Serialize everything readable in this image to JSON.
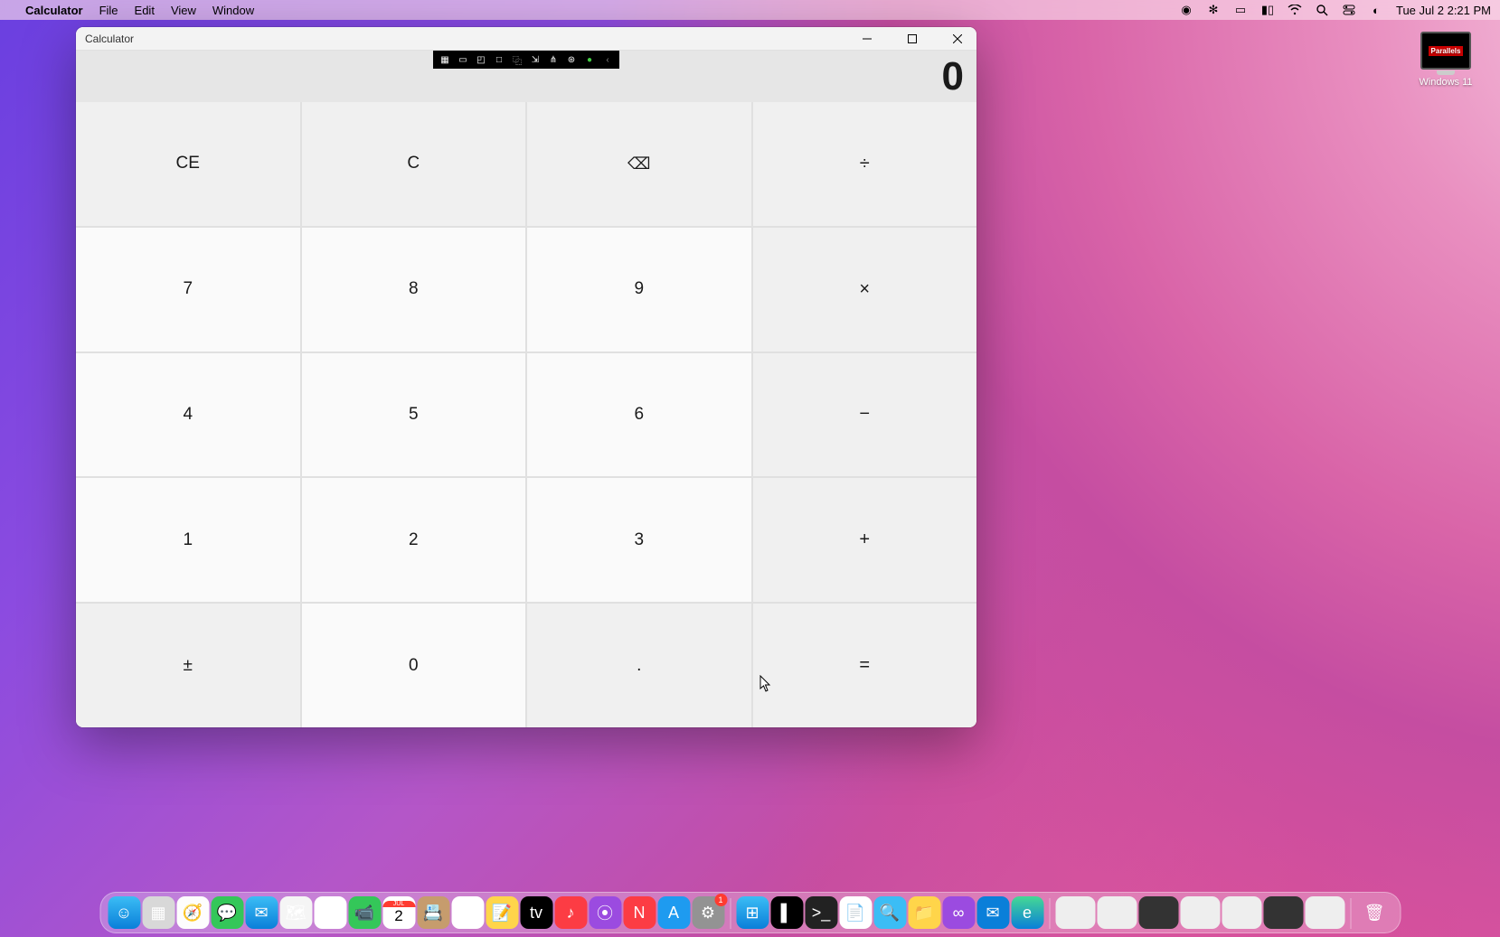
{
  "menubar": {
    "apple_icon": "apple-logo",
    "app_name": "Calculator",
    "menus": [
      "File",
      "Edit",
      "View",
      "Window"
    ],
    "status_icons": [
      "record-icon",
      "shield-icon",
      "screen-mirror-icon",
      "battery-icon",
      "wifi-icon",
      "search-icon",
      "control-center-icon",
      "siri-icon"
    ],
    "clock": "Tue Jul 2  2:21 PM"
  },
  "desktop_icon": {
    "label": "Windows 11",
    "brand": "Parallels"
  },
  "calculator": {
    "title": "Calculator",
    "display": "0",
    "window_buttons": {
      "min": "minimize",
      "max": "maximize",
      "close": "close"
    },
    "keys": {
      "ce": "CE",
      "c": "C",
      "back": "⌫",
      "div": "÷",
      "seven": "7",
      "eight": "8",
      "nine": "9",
      "mul": "×",
      "four": "4",
      "five": "5",
      "six": "6",
      "sub": "−",
      "one": "1",
      "two": "2",
      "three": "3",
      "add": "+",
      "neg": "±",
      "zero": "0",
      "dot": ".",
      "eq": "="
    },
    "floating_toolbar_icons": [
      "coherence-icon",
      "camera-icon",
      "pointer-icon",
      "window-icon",
      "clipboard-icon",
      "share-icon",
      "usb-icon",
      "accessibility-icon",
      "check-icon",
      "collapse-icon"
    ]
  },
  "dock": {
    "calendar_month": "JUL",
    "calendar_day": "2",
    "settings_badge": "1"
  }
}
